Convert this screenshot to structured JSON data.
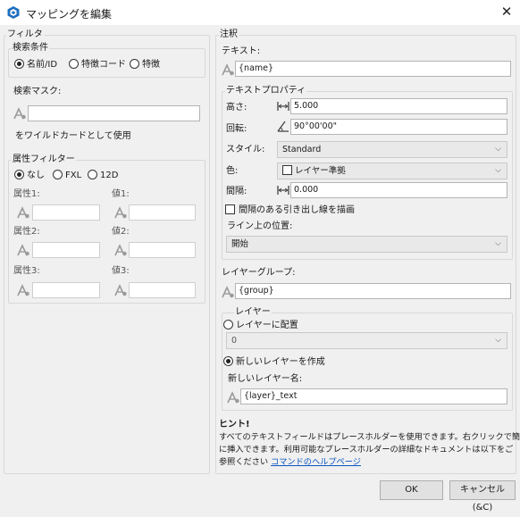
{
  "window": {
    "title": "マッピングを編集",
    "close_glyph": "✕"
  },
  "filter": {
    "legend": "フィルタ",
    "search_condition": {
      "legend": "検索条件",
      "options": [
        "名前/ID",
        "特徴コード",
        "特徴"
      ],
      "selected": 0
    },
    "search_mask": {
      "label": "検索マスク:",
      "value": ""
    },
    "wildcard_label": "をワイルドカードとして使用",
    "attribute_filter": {
      "legend": "属性フィルター",
      "options": [
        "なし",
        "FXL",
        "12D"
      ],
      "selected": 0,
      "attr1_label": "属性1:",
      "val1_label": "値1:",
      "attr2_label": "属性2:",
      "val2_label": "値2:",
      "attr3_label": "属性3:",
      "val3_label": "値3:"
    }
  },
  "annotation": {
    "legend": "注釈",
    "text_label": "テキスト:",
    "text_value": "{name}",
    "text_properties": {
      "legend": "テキストプロパティ",
      "height_label": "高さ:",
      "height_value": "5.000",
      "rotation_label": "回転:",
      "rotation_value": "90°00'00\"",
      "style_label": "スタイル:",
      "style_value": "Standard",
      "color_label": "色:",
      "color_value": "レイヤー準拠",
      "spacing_label": "間隔:",
      "spacing_value": "0.000",
      "leader_label": "間隔のある引き出し線を描画",
      "position_label": "ライン上の位置:",
      "position_value": "開始"
    },
    "layer_group_label": "レイヤーグループ:",
    "layer_group_value": "{group}",
    "layer": {
      "legend": "レイヤー",
      "place_on_layer": "レイヤーに配置",
      "layer_select_value": "0",
      "create_new": "新しいレイヤーを作成",
      "new_name_label": "新しいレイヤー名:",
      "new_name_value": "{layer}_text"
    },
    "hint": {
      "title": "ヒント!",
      "line1": "すべてのテキストフィールドはプレースホルダーを使用できます。右クリックで簡単",
      "line2": "に挿入できます。利用可能なプレースホルダーの詳細なドキュメントは以下をご",
      "line3_prefix": "参照ください ",
      "link": "コマンドのヘルプページ"
    }
  },
  "buttons": {
    "ok": "OK",
    "cancel": "キャンセル(&C)"
  },
  "icons": {
    "app": "app-cube-icon",
    "placeholder": "placeholder-insert-icon",
    "height": "height-dimension-icon",
    "rotation": "rotation-angle-icon",
    "spacing": "spacing-dimension-icon"
  },
  "colors": {
    "accent": "#1f6fc0",
    "link": "#0a56c2"
  }
}
